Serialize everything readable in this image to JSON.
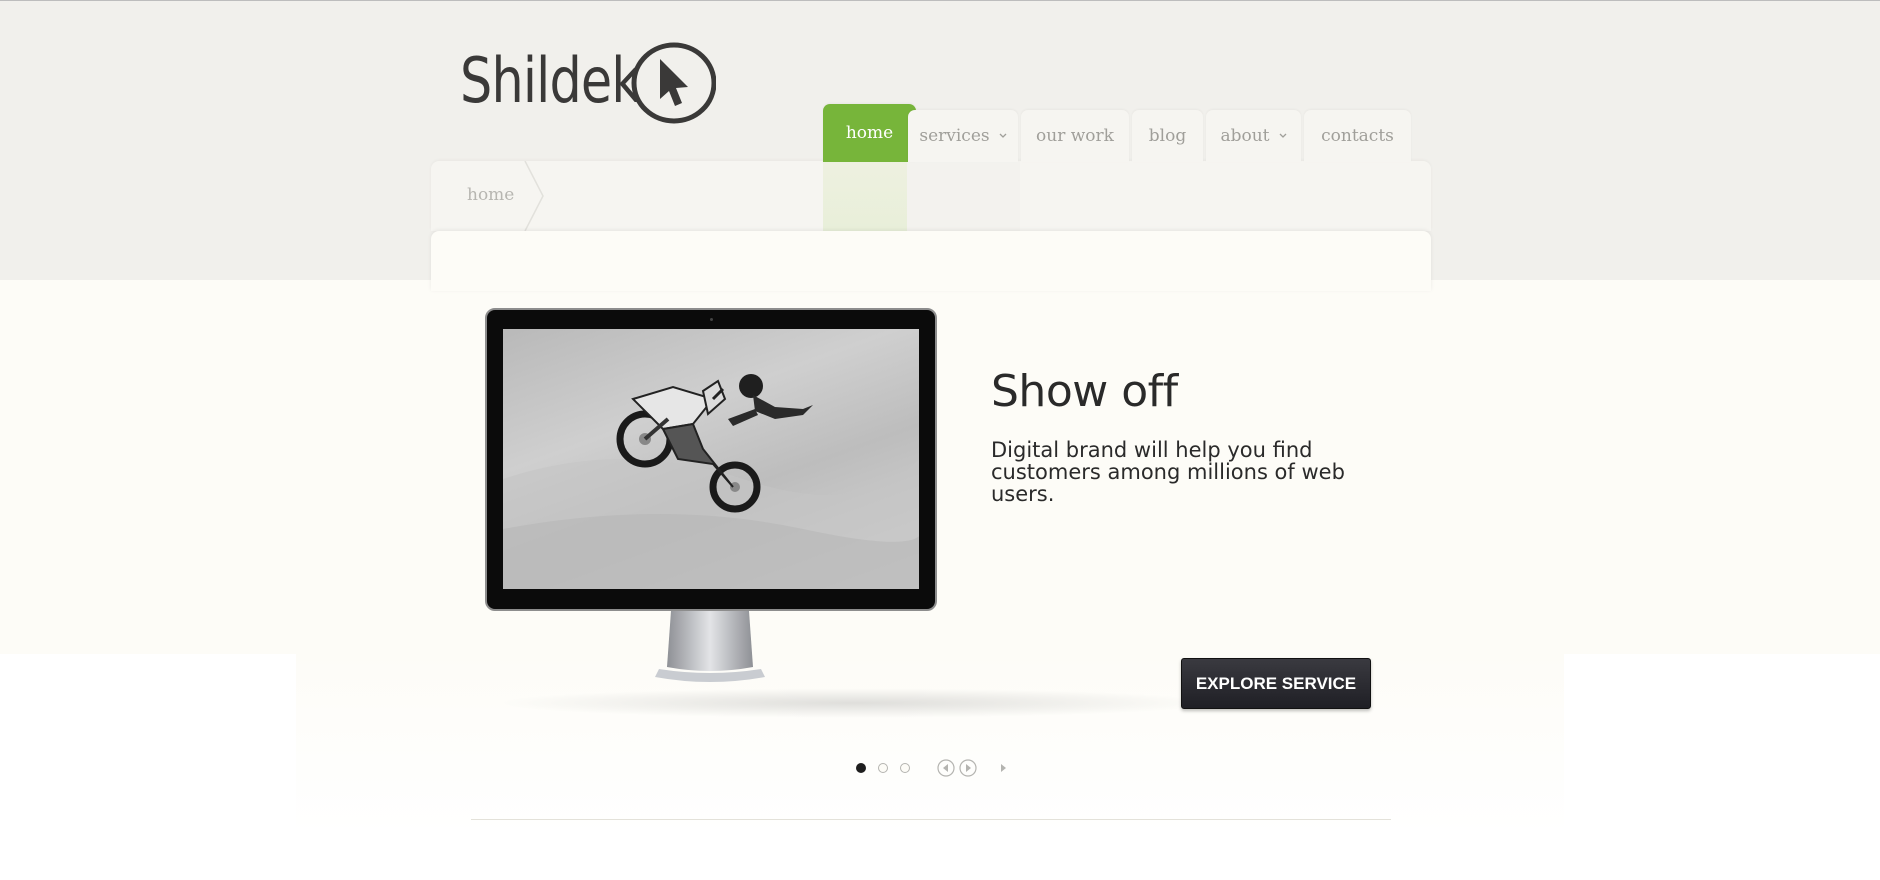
{
  "brand": {
    "name": "Shildek",
    "accent": "#77b53a",
    "dark": "#3a3938"
  },
  "nav": {
    "items": [
      {
        "label": "home",
        "active": true
      },
      {
        "label": "services",
        "has_dropdown": true
      },
      {
        "label": "our work"
      },
      {
        "label": "blog"
      },
      {
        "label": "about",
        "has_dropdown": true
      },
      {
        "label": "contacts"
      }
    ]
  },
  "breadcrumb": {
    "current": "home"
  },
  "slider": {
    "title": "Show off",
    "description": "Digital brand will help you find customers among millions of web users.",
    "cta_label": "EXPLORE SERVICE",
    "image": "motocross-rider-jump-photo",
    "pager": {
      "count": 3,
      "active_index": 0
    },
    "controls": [
      "prev-icon",
      "play-icon",
      "next-icon"
    ]
  }
}
